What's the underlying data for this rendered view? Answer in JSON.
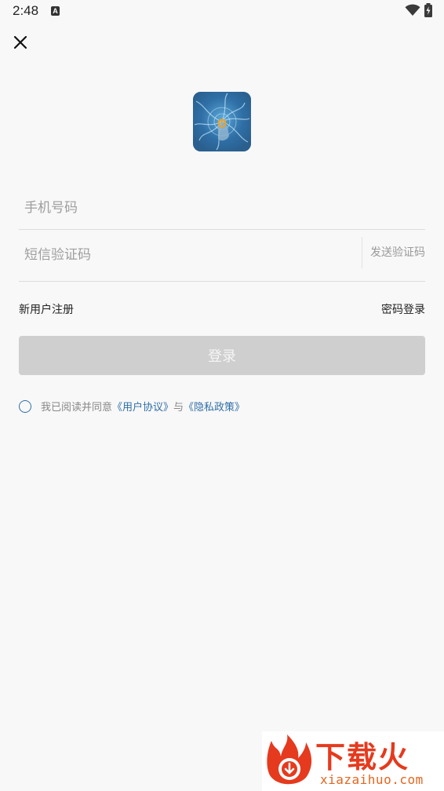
{
  "status_bar": {
    "time": "2:48",
    "notification_icon": "A"
  },
  "icons": {
    "close": "close-icon",
    "wifi": "wifi-icon",
    "battery": "battery-charging-icon",
    "app_logo": "app-logo"
  },
  "form": {
    "phone_placeholder": "手机号码",
    "sms_placeholder": "短信验证码",
    "send_code_label": "发送验证码",
    "register_label": "新用户注册",
    "password_login_label": "密码登录",
    "login_button_label": "登录"
  },
  "agreement": {
    "prefix": "我已阅读并同意",
    "user_agreement": "《用户协议》",
    "conjunction": "与",
    "privacy_policy": "《隐私政策》"
  },
  "watermark": {
    "brand": "下载火",
    "url": "xiazaihuo.com"
  },
  "colors": {
    "accent": "#2f6fa6",
    "button_disabled": "#cfcfcf",
    "watermark": "#e53a1e"
  }
}
